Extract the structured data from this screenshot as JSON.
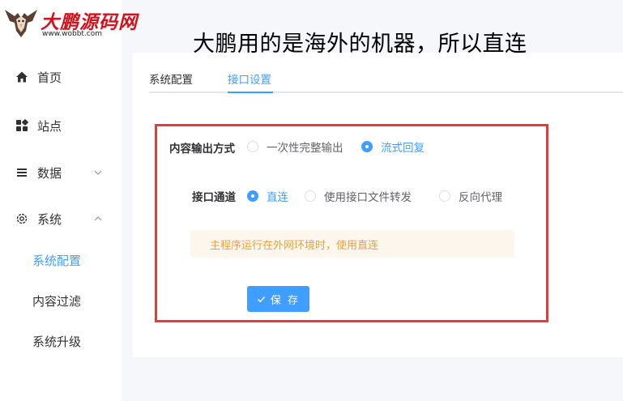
{
  "logo": {
    "name": "大鹏源码网",
    "url": "www.wobbt.com"
  },
  "overlay": {
    "heading": "大鹏用的是海外的机器，所以直连"
  },
  "sidebar": {
    "items": [
      {
        "label": "首页",
        "icon": "home-icon"
      },
      {
        "label": "站点",
        "icon": "grid-icon"
      },
      {
        "label": "数据",
        "icon": "list-icon"
      },
      {
        "label": "系统",
        "icon": "gear-icon"
      }
    ],
    "sub_items": [
      {
        "label": "系统配置",
        "active": true
      },
      {
        "label": "内容过滤",
        "active": false
      },
      {
        "label": "系统升级",
        "active": false
      }
    ]
  },
  "tabs": [
    {
      "label": "系统配置",
      "active": false
    },
    {
      "label": "接口设置",
      "active": true
    }
  ],
  "form": {
    "output_mode": {
      "label": "内容输出方式",
      "options": [
        {
          "label": "一次性完整输出",
          "checked": false
        },
        {
          "label": "流式回复",
          "checked": true
        }
      ]
    },
    "channel": {
      "label": "接口通道",
      "options": [
        {
          "label": "直连",
          "checked": true
        },
        {
          "label": "使用接口文件转发",
          "checked": false
        },
        {
          "label": "反向代理",
          "checked": false
        }
      ]
    },
    "alert": "主程序运行在外网环境时，使用直连",
    "save_label": "保 存"
  },
  "colors": {
    "accent": "#409eff",
    "highlight_border": "#e43c3c",
    "warning_text": "#e6a23c",
    "warning_bg": "#fdf6ec",
    "logo_red": "#d0131c"
  }
}
